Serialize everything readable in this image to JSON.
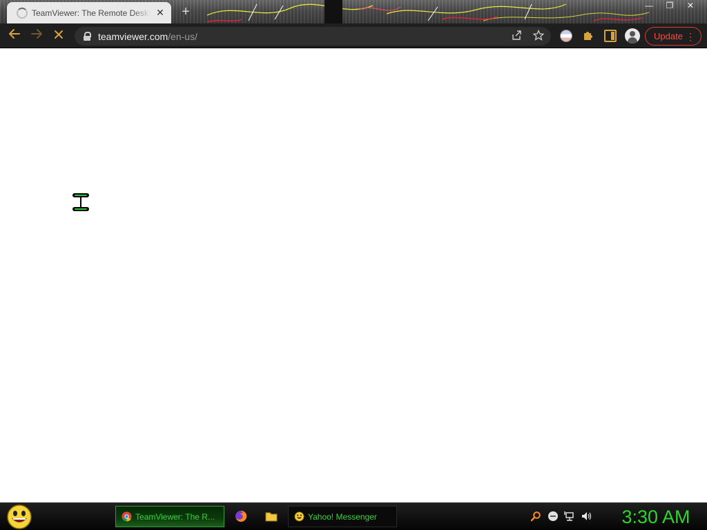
{
  "browser": {
    "tab": {
      "title": "TeamViewer: The Remote Desktop Software",
      "close_label": "✕"
    },
    "new_tab_label": "+",
    "window_controls": {
      "minimize": "—",
      "restore": "❐",
      "close": "✕"
    },
    "address": {
      "host": "teamviewer.com",
      "path": "/en-us/"
    },
    "update_button": {
      "label": "Update",
      "menu": "⋮"
    }
  },
  "taskbar": {
    "tasks": [
      {
        "label": "TeamViewer: The R...",
        "icon": "chrome-icon"
      },
      {
        "label": "Yahoo! Messenger",
        "icon": "yahoo-smiley-icon"
      }
    ],
    "quick_launch": [
      "firefox-icon",
      "folder-icon"
    ],
    "tray": [
      "search-icon",
      "messenger-status-icon",
      "network-icon",
      "volume-icon"
    ],
    "clock": "3:30 AM"
  },
  "colors": {
    "accent_gold": "#d6a33c",
    "update_red": "#ff4a3d",
    "taskbar_green": "#2bd62b",
    "toolbar_bg": "#1e1f1e"
  }
}
